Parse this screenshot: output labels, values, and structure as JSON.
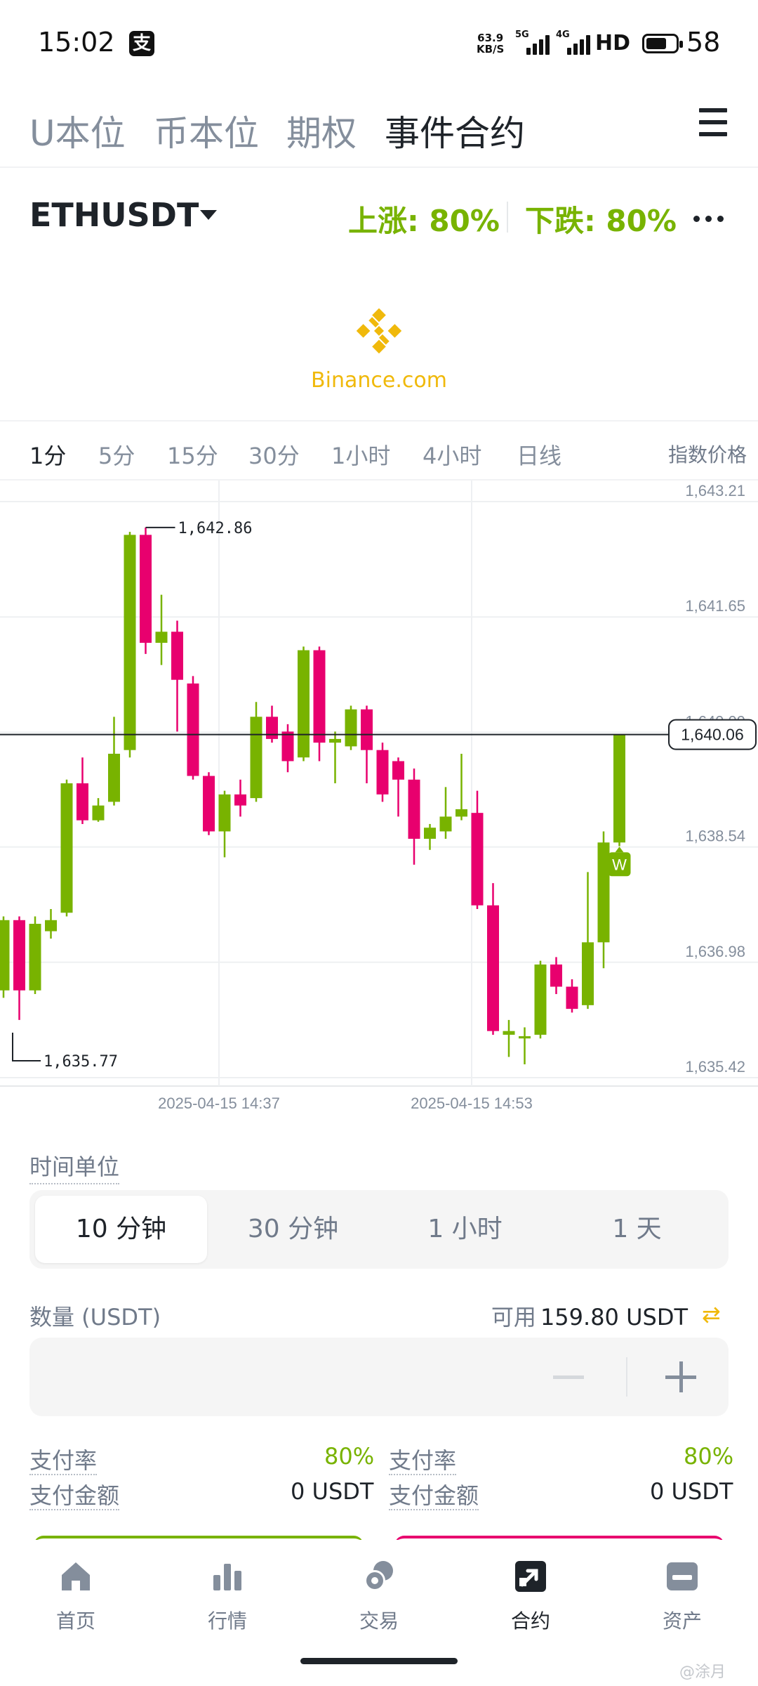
{
  "status_bar": {
    "time": "15:02",
    "app_badge": "支",
    "net_speed_value": "63.9",
    "net_speed_unit": "KB/S",
    "sim1_label": "5G",
    "sim2_label": "4G",
    "hd_label": "HD",
    "battery_level": "58"
  },
  "top_tabs": [
    {
      "label": "U本位"
    },
    {
      "label": "币本位"
    },
    {
      "label": "期权"
    },
    {
      "label": "事件合约"
    }
  ],
  "top_tabs_active": "事件合约",
  "symbol": {
    "name": "ETHUSDT",
    "up_label": "上涨: 80%",
    "down_label": "下跌: 80%"
  },
  "logo": {
    "text": "Binance.com",
    "color": "#f0b90b"
  },
  "intervals": [
    {
      "label": "1分"
    },
    {
      "label": "5分"
    },
    {
      "label": "15分"
    },
    {
      "label": "30分"
    },
    {
      "label": "1小时"
    },
    {
      "label": "4小时"
    },
    {
      "label": "日线"
    }
  ],
  "interval_active": "1分",
  "index_price_label": "指数价格",
  "chart_data": {
    "type": "candlestick",
    "y_axis_ticks": [
      "1,643.21",
      "1,641.65",
      "1,640.09",
      "1,638.54",
      "1,636.98",
      "1,635.42"
    ],
    "ylim": [
      1635.42,
      1643.21
    ],
    "x_axis_ticks": [
      "2025-04-15 14:37",
      "2025-04-15 14:53"
    ],
    "high_marker": "1,642.86",
    "low_marker": "1,635.77",
    "current_price": "1,640.06",
    "current_marker": "W",
    "up_color": "#78b300",
    "down_color": "#e8006e",
    "candles": [
      {
        "o": 1636.6,
        "c": 1637.55,
        "h": 1637.6,
        "l": 1636.5
      },
      {
        "o": 1637.55,
        "c": 1636.6,
        "h": 1637.6,
        "l": 1636.2
      },
      {
        "o": 1636.6,
        "c": 1637.5,
        "h": 1637.6,
        "l": 1636.55
      },
      {
        "o": 1637.4,
        "c": 1637.55,
        "h": 1637.7,
        "l": 1637.3
      },
      {
        "o": 1637.65,
        "c": 1639.4,
        "h": 1639.45,
        "l": 1637.6
      },
      {
        "o": 1639.4,
        "c": 1638.9,
        "h": 1639.75,
        "l": 1638.85
      },
      {
        "o": 1638.9,
        "c": 1639.1,
        "h": 1639.2,
        "l": 1638.88
      },
      {
        "o": 1639.15,
        "c": 1639.8,
        "h": 1640.3,
        "l": 1639.1
      },
      {
        "o": 1639.85,
        "c": 1642.76,
        "h": 1642.8,
        "l": 1639.75
      },
      {
        "o": 1642.76,
        "c": 1641.3,
        "h": 1642.86,
        "l": 1641.15
      },
      {
        "o": 1641.3,
        "c": 1641.45,
        "h": 1641.95,
        "l": 1641.0
      },
      {
        "o": 1641.45,
        "c": 1640.8,
        "h": 1641.6,
        "l": 1640.1
      },
      {
        "o": 1640.75,
        "c": 1639.5,
        "h": 1640.85,
        "l": 1639.45
      },
      {
        "o": 1639.5,
        "c": 1638.75,
        "h": 1639.55,
        "l": 1638.7
      },
      {
        "o": 1638.75,
        "c": 1639.25,
        "h": 1639.3,
        "l": 1638.4
      },
      {
        "o": 1639.25,
        "c": 1639.1,
        "h": 1639.45,
        "l": 1638.95
      },
      {
        "o": 1639.2,
        "c": 1640.3,
        "h": 1640.5,
        "l": 1639.15
      },
      {
        "o": 1640.3,
        "c": 1640.0,
        "h": 1640.45,
        "l": 1639.95
      },
      {
        "o": 1640.1,
        "c": 1639.7,
        "h": 1640.2,
        "l": 1639.55
      },
      {
        "o": 1639.75,
        "c": 1641.2,
        "h": 1641.25,
        "l": 1639.7
      },
      {
        "o": 1641.2,
        "c": 1639.95,
        "h": 1641.25,
        "l": 1639.7
      },
      {
        "o": 1639.95,
        "c": 1640.0,
        "h": 1640.1,
        "l": 1639.4
      },
      {
        "o": 1639.9,
        "c": 1640.4,
        "h": 1640.45,
        "l": 1639.85
      },
      {
        "o": 1640.4,
        "c": 1639.85,
        "h": 1640.45,
        "l": 1639.4
      },
      {
        "o": 1639.85,
        "c": 1639.25,
        "h": 1639.95,
        "l": 1639.15
      },
      {
        "o": 1639.7,
        "c": 1639.45,
        "h": 1639.75,
        "l": 1638.95
      },
      {
        "o": 1639.45,
        "c": 1638.65,
        "h": 1639.6,
        "l": 1638.3
      },
      {
        "o": 1638.65,
        "c": 1638.8,
        "h": 1638.85,
        "l": 1638.5
      },
      {
        "o": 1638.75,
        "c": 1638.95,
        "h": 1639.35,
        "l": 1638.65
      },
      {
        "o": 1638.95,
        "c": 1639.05,
        "h": 1639.8,
        "l": 1638.9
      },
      {
        "o": 1639.0,
        "c": 1637.75,
        "h": 1639.3,
        "l": 1637.7
      },
      {
        "o": 1637.75,
        "c": 1636.05,
        "h": 1638.05,
        "l": 1636.0
      },
      {
        "o": 1636.0,
        "c": 1636.05,
        "h": 1636.2,
        "l": 1635.7
      },
      {
        "o": 1635.95,
        "c": 1635.98,
        "h": 1636.1,
        "l": 1635.6
      },
      {
        "o": 1636.0,
        "c": 1636.95,
        "h": 1637.0,
        "l": 1635.95
      },
      {
        "o": 1636.95,
        "c": 1636.65,
        "h": 1637.05,
        "l": 1636.55
      },
      {
        "o": 1636.65,
        "c": 1636.35,
        "h": 1636.75,
        "l": 1636.3
      },
      {
        "o": 1636.4,
        "c": 1637.25,
        "h": 1638.2,
        "l": 1636.35
      },
      {
        "o": 1637.25,
        "c": 1638.6,
        "h": 1638.75,
        "l": 1636.9
      },
      {
        "o": 1638.6,
        "c": 1640.06,
        "h": 1640.06,
        "l": 1638.55
      }
    ]
  },
  "time_unit": {
    "label": "时间单位",
    "options": [
      {
        "label": "10 分钟"
      },
      {
        "label": "30 分钟"
      },
      {
        "label": "1 小时"
      },
      {
        "label": "1 天"
      }
    ],
    "selected": "10 分钟"
  },
  "quantity": {
    "label": "数量 (USDT)",
    "available_label": "可用",
    "available_value": "159.80 USDT",
    "value": ""
  },
  "payout": {
    "left": {
      "rate_label": "支付率",
      "rate_value": "80%",
      "amount_label": "支付金额",
      "amount_value": "0 USDT"
    },
    "right": {
      "rate_label": "支付率",
      "rate_value": "80%",
      "amount_label": "支付金额",
      "amount_value": "0 USDT"
    }
  },
  "bottom_nav": [
    {
      "label": "首页",
      "icon": "home-icon"
    },
    {
      "label": "行情",
      "icon": "bar-chart-icon"
    },
    {
      "label": "交易",
      "icon": "trade-icon"
    },
    {
      "label": "合约",
      "icon": "futures-icon"
    },
    {
      "label": "资产",
      "icon": "wallet-icon"
    }
  ],
  "bottom_nav_active": "合约",
  "watermark": "@涂月"
}
